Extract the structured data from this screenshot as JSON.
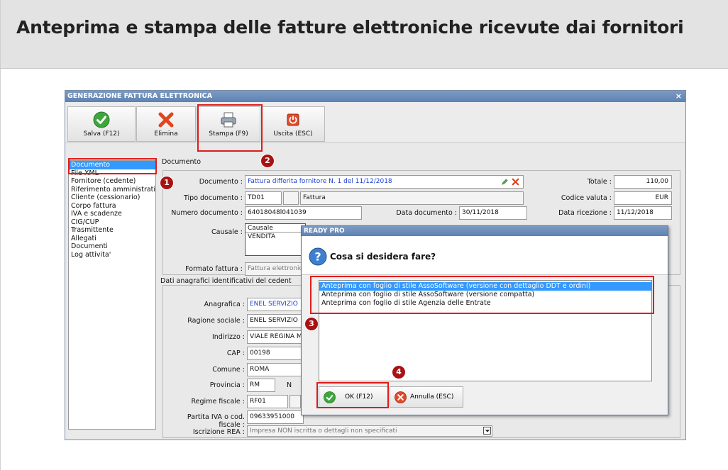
{
  "page": {
    "title": "Anteprima e stampa delle fatture elettroniche ricevute dai fornitori"
  },
  "window": {
    "title": "GENERAZIONE FATTURA ELETTRONICA",
    "close": "×",
    "toolbar": {
      "save": "Salva (F12)",
      "delete": "Elimina",
      "print": "Stampa (F9)",
      "exit": "Uscita (ESC)"
    },
    "nav": {
      "items": [
        "Documento",
        "File XML",
        "Fornitore (cedente)",
        "Riferimento amministrativo",
        "Cliente (cessionario)",
        "Corpo fattura",
        "IVA e scadenze",
        "CIG/CUP",
        "Trasmittente",
        "Allegati",
        "Documenti",
        "Log attivita'"
      ]
    },
    "documento": {
      "group_label": "Documento",
      "documento_label": "Documento :",
      "documento_value": "Fattura differita fornitore N. 1 del 11/12/2018",
      "tipo_label": "Tipo documento :",
      "tipo_code": "TD01",
      "tipo_desc": "Fattura",
      "numero_label": "Numero documento :",
      "numero_value": "64018048l041039",
      "data_doc_label": "Data documento :",
      "data_doc_value": "30/11/2018",
      "totale_label": "Totale :",
      "totale_value": "110,00",
      "valuta_label": "Codice valuta :",
      "valuta_value": "EUR",
      "ricezione_label": "Data ricezione :",
      "ricezione_value": "11/12/2018",
      "causale_label": "Causale :",
      "causale_header": "Causale",
      "causale_row": "VENDITA",
      "formato_label": "Formato fattura :",
      "formato_value": "Fattura elettronica"
    },
    "cedente": {
      "group_label": "Dati anagrafici identificativi del cedent",
      "anagrafica_label": "Anagrafica :",
      "anagrafica_value": "ENEL SERVIZIO",
      "ragione_label": "Ragione sociale :",
      "ragione_value": "ENEL SERVIZIO",
      "indirizzo_label": "Indirizzo :",
      "indirizzo_value": "VIALE REGINA M",
      "cap_label": "CAP :",
      "cap_value": "00198",
      "comune_label": "Comune :",
      "comune_value": "ROMA",
      "provincia_label": "Provincia :",
      "provincia_value": "RM",
      "nazione_short": "N",
      "regime_label": "Regime fiscale :",
      "regime_value": "RF01",
      "piva_label": "Partita IVA o cod. fiscale :",
      "piva_value": "09633951000",
      "rea_label": "Iscrizione REA :",
      "rea_value": "Impresa NON iscritta o dettagli non specificati"
    }
  },
  "dialog": {
    "title": "READY PRO",
    "question": "Cosa si desidera fare?",
    "options": [
      "Anteprima con foglio di stile AssoSoftware (versione con dettaglio DDT e ordini)",
      "Anteprima con foglio di stile AssoSoftware (versione compatta)",
      "Anteprima con foglio di stile Agenzia delle Entrate"
    ],
    "ok": "OK (F12)",
    "cancel": "Annulla (ESC)"
  },
  "badges": [
    "1",
    "2",
    "3",
    "4"
  ],
  "colors": {
    "highlight": "#e11b1b",
    "badge": "#a81212",
    "selection": "#3399ff",
    "title_bar": "#5d82b4"
  }
}
